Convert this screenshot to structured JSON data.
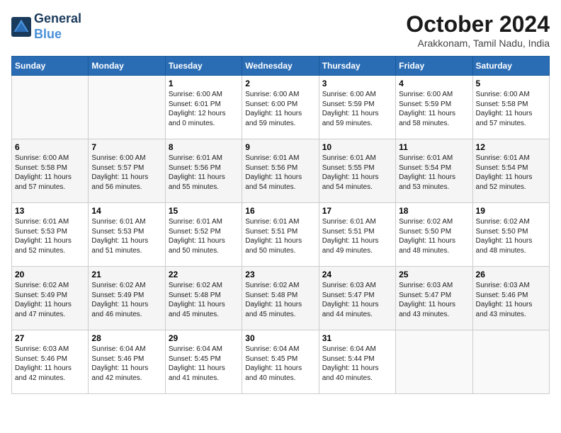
{
  "logo": {
    "line1": "General",
    "line2": "Blue"
  },
  "title": "October 2024",
  "location": "Arakkonam, Tamil Nadu, India",
  "days_header": [
    "Sunday",
    "Monday",
    "Tuesday",
    "Wednesday",
    "Thursday",
    "Friday",
    "Saturday"
  ],
  "weeks": [
    [
      {
        "day": "",
        "info": ""
      },
      {
        "day": "",
        "info": ""
      },
      {
        "day": "1",
        "info": "Sunrise: 6:00 AM\nSunset: 6:01 PM\nDaylight: 12 hours\nand 0 minutes."
      },
      {
        "day": "2",
        "info": "Sunrise: 6:00 AM\nSunset: 6:00 PM\nDaylight: 11 hours\nand 59 minutes."
      },
      {
        "day": "3",
        "info": "Sunrise: 6:00 AM\nSunset: 5:59 PM\nDaylight: 11 hours\nand 59 minutes."
      },
      {
        "day": "4",
        "info": "Sunrise: 6:00 AM\nSunset: 5:59 PM\nDaylight: 11 hours\nand 58 minutes."
      },
      {
        "day": "5",
        "info": "Sunrise: 6:00 AM\nSunset: 5:58 PM\nDaylight: 11 hours\nand 57 minutes."
      }
    ],
    [
      {
        "day": "6",
        "info": "Sunrise: 6:00 AM\nSunset: 5:58 PM\nDaylight: 11 hours\nand 57 minutes."
      },
      {
        "day": "7",
        "info": "Sunrise: 6:00 AM\nSunset: 5:57 PM\nDaylight: 11 hours\nand 56 minutes."
      },
      {
        "day": "8",
        "info": "Sunrise: 6:01 AM\nSunset: 5:56 PM\nDaylight: 11 hours\nand 55 minutes."
      },
      {
        "day": "9",
        "info": "Sunrise: 6:01 AM\nSunset: 5:56 PM\nDaylight: 11 hours\nand 54 minutes."
      },
      {
        "day": "10",
        "info": "Sunrise: 6:01 AM\nSunset: 5:55 PM\nDaylight: 11 hours\nand 54 minutes."
      },
      {
        "day": "11",
        "info": "Sunrise: 6:01 AM\nSunset: 5:54 PM\nDaylight: 11 hours\nand 53 minutes."
      },
      {
        "day": "12",
        "info": "Sunrise: 6:01 AM\nSunset: 5:54 PM\nDaylight: 11 hours\nand 52 minutes."
      }
    ],
    [
      {
        "day": "13",
        "info": "Sunrise: 6:01 AM\nSunset: 5:53 PM\nDaylight: 11 hours\nand 52 minutes."
      },
      {
        "day": "14",
        "info": "Sunrise: 6:01 AM\nSunset: 5:53 PM\nDaylight: 11 hours\nand 51 minutes."
      },
      {
        "day": "15",
        "info": "Sunrise: 6:01 AM\nSunset: 5:52 PM\nDaylight: 11 hours\nand 50 minutes."
      },
      {
        "day": "16",
        "info": "Sunrise: 6:01 AM\nSunset: 5:51 PM\nDaylight: 11 hours\nand 50 minutes."
      },
      {
        "day": "17",
        "info": "Sunrise: 6:01 AM\nSunset: 5:51 PM\nDaylight: 11 hours\nand 49 minutes."
      },
      {
        "day": "18",
        "info": "Sunrise: 6:02 AM\nSunset: 5:50 PM\nDaylight: 11 hours\nand 48 minutes."
      },
      {
        "day": "19",
        "info": "Sunrise: 6:02 AM\nSunset: 5:50 PM\nDaylight: 11 hours\nand 48 minutes."
      }
    ],
    [
      {
        "day": "20",
        "info": "Sunrise: 6:02 AM\nSunset: 5:49 PM\nDaylight: 11 hours\nand 47 minutes."
      },
      {
        "day": "21",
        "info": "Sunrise: 6:02 AM\nSunset: 5:49 PM\nDaylight: 11 hours\nand 46 minutes."
      },
      {
        "day": "22",
        "info": "Sunrise: 6:02 AM\nSunset: 5:48 PM\nDaylight: 11 hours\nand 45 minutes."
      },
      {
        "day": "23",
        "info": "Sunrise: 6:02 AM\nSunset: 5:48 PM\nDaylight: 11 hours\nand 45 minutes."
      },
      {
        "day": "24",
        "info": "Sunrise: 6:03 AM\nSunset: 5:47 PM\nDaylight: 11 hours\nand 44 minutes."
      },
      {
        "day": "25",
        "info": "Sunrise: 6:03 AM\nSunset: 5:47 PM\nDaylight: 11 hours\nand 43 minutes."
      },
      {
        "day": "26",
        "info": "Sunrise: 6:03 AM\nSunset: 5:46 PM\nDaylight: 11 hours\nand 43 minutes."
      }
    ],
    [
      {
        "day": "27",
        "info": "Sunrise: 6:03 AM\nSunset: 5:46 PM\nDaylight: 11 hours\nand 42 minutes."
      },
      {
        "day": "28",
        "info": "Sunrise: 6:04 AM\nSunset: 5:46 PM\nDaylight: 11 hours\nand 42 minutes."
      },
      {
        "day": "29",
        "info": "Sunrise: 6:04 AM\nSunset: 5:45 PM\nDaylight: 11 hours\nand 41 minutes."
      },
      {
        "day": "30",
        "info": "Sunrise: 6:04 AM\nSunset: 5:45 PM\nDaylight: 11 hours\nand 40 minutes."
      },
      {
        "day": "31",
        "info": "Sunrise: 6:04 AM\nSunset: 5:44 PM\nDaylight: 11 hours\nand 40 minutes."
      },
      {
        "day": "",
        "info": ""
      },
      {
        "day": "",
        "info": ""
      }
    ]
  ]
}
